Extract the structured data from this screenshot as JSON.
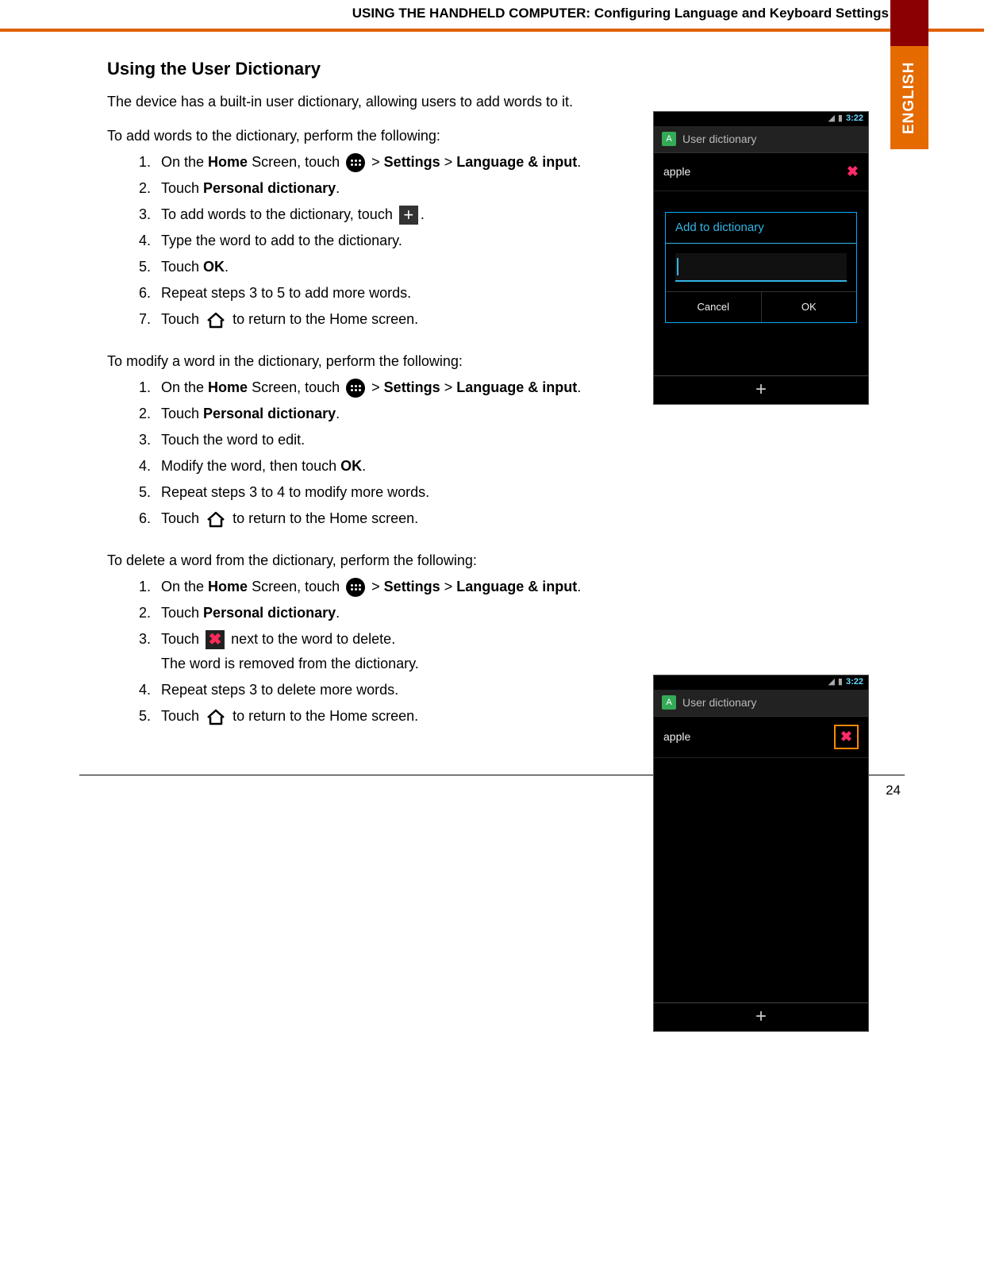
{
  "header": {
    "title": "USING THE HANDHELD COMPUTER: Configuring Language and Keyboard Settings"
  },
  "sidebar": {
    "language_tab": "ENGLISH"
  },
  "section": {
    "heading": "Using the User Dictionary",
    "intro": "The device has a built-in user dictionary, allowing users to add words to it."
  },
  "add": {
    "lead": "To add words to the dictionary, perform the following:",
    "s1a": "On the ",
    "s1b": "Home",
    "s1c": " Screen, touch ",
    "s1d": "  > ",
    "s1e": "Settings",
    "s1f": " > ",
    "s1g": "Language & input",
    "s1h": ".",
    "s2a": "Touch ",
    "s2b": "Personal dictionary",
    "s2c": ".",
    "s3a": "To add words to the dictionary, touch ",
    "s3b": ".",
    "s4": "Type the word to add to the dictionary.",
    "s5a": "Touch ",
    "s5b": "OK",
    "s5c": ".",
    "s6": "Repeat steps 3 to 5 to add more words.",
    "s7a": "Touch ",
    "s7b": " to return to the Home screen."
  },
  "modify": {
    "lead": "To modify a word in the dictionary, perform the following:",
    "s1a": "On the ",
    "s1b": "Home",
    "s1c": " Screen, touch ",
    "s1d": "  > ",
    "s1e": "Settings",
    "s1f": " > ",
    "s1g": "Language & input",
    "s1h": ".",
    "s2a": "Touch ",
    "s2b": "Personal dictionary",
    "s2c": ".",
    "s3": "Touch the word to edit.",
    "s4a": "Modify the word, then touch ",
    "s4b": "OK",
    "s4c": ".",
    "s5": "Repeat steps 3 to 4 to modify more words.",
    "s6a": "Touch ",
    "s6b": " to return to the Home screen."
  },
  "del": {
    "lead": "To delete a word from the dictionary, perform the following:",
    "s1a": "On the ",
    "s1b": "Home",
    "s1c": " Screen, touch ",
    "s1d": " > ",
    "s1e": "Settings",
    "s1f": " > ",
    "s1g": "Language & input",
    "s1h": ".",
    "s2a": "Touch ",
    "s2b": "Personal dictionary",
    "s2c": ".",
    "s3a": "Touch ",
    "s3b": " next to the word to delete.",
    "s3sub": "The word is removed from the dictionary.",
    "s4": "Repeat steps 3 to delete more words.",
    "s5a": "Touch ",
    "s5b": " to return to the Home screen."
  },
  "phone": {
    "time": "3:22",
    "title": "User dictionary",
    "entry": "apple",
    "dialog_title": "Add to dictionary",
    "btn_cancel": "Cancel",
    "btn_ok": "OK",
    "plus": "+",
    "delete_glyph": "✖"
  },
  "page_number": "24"
}
